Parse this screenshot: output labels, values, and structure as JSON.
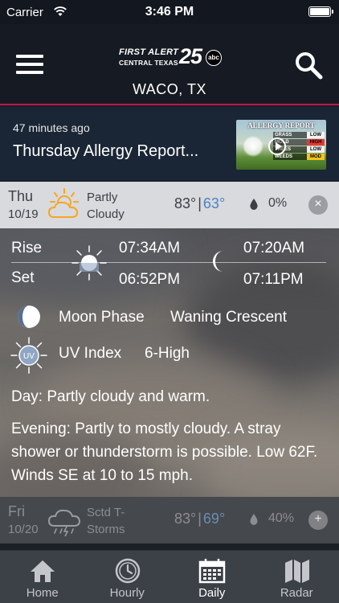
{
  "status_bar": {
    "carrier": "Carrier",
    "time": "3:46 PM"
  },
  "header": {
    "logo": {
      "line1": "FIRST ALERT",
      "line2": "CENTRAL TEXAS",
      "channel": "25",
      "network": "abc"
    },
    "location": "WACO, TX"
  },
  "news": {
    "time_ago": "47 minutes ago",
    "title": "Thursday Allergy Report...",
    "thumbnail": {
      "title": "ALLERGY REPORT",
      "rows": [
        {
          "name": "GRASS",
          "level": "LOW",
          "color": "#f2f2f2"
        },
        {
          "name": "MOLD",
          "level": "HIGH",
          "color": "#e53935"
        },
        {
          "name": "TREES",
          "level": "LOW",
          "color": "#f2f2f2"
        },
        {
          "name": "WEEDS",
          "level": "MOD",
          "color": "#f5c518"
        }
      ]
    }
  },
  "days": [
    {
      "dow": "Thu",
      "date": "10/19",
      "condition": "Partly Cloudy",
      "high": "83°",
      "sep": "|",
      "low": "63°",
      "precip": "0%",
      "toggle": "×",
      "expanded": true,
      "icon": "partly-cloudy-icon"
    },
    {
      "dow": "Fri",
      "date": "10/20",
      "condition": "Sctd T-Storms",
      "high": "83°",
      "sep": "|",
      "low": "69°",
      "precip": "40%",
      "toggle": "+",
      "expanded": false,
      "icon": "thunderstorm-icon"
    }
  ],
  "detail": {
    "rise_label": "Rise",
    "set_label": "Set",
    "sunrise": "07:34AM",
    "sunset": "06:52PM",
    "moonrise": "07:20AM",
    "moonset": "07:11PM",
    "moon_phase_label": "Moon Phase",
    "moon_phase": "Waning Crescent",
    "uv_label": "UV Index",
    "uv_value": "6-High",
    "uv_badge": "UV",
    "day_text": "Day: Partly cloudy and warm.",
    "evening_text": "Evening: Partly to mostly cloudy. A stray shower or thunderstorm is possible. Low 62F. Winds SE at 10 to 15 mph."
  },
  "tabs": [
    {
      "label": "Home",
      "icon": "home-icon",
      "active": false
    },
    {
      "label": "Hourly",
      "icon": "clock-icon",
      "active": false
    },
    {
      "label": "Daily",
      "icon": "calendar-icon",
      "active": true
    },
    {
      "label": "Radar",
      "icon": "map-icon",
      "active": false
    }
  ],
  "colors": {
    "accent": "#c0174a",
    "low_temp": "#4a83c4",
    "header_bg": "#161a22",
    "news_bg": "#1a2635"
  }
}
